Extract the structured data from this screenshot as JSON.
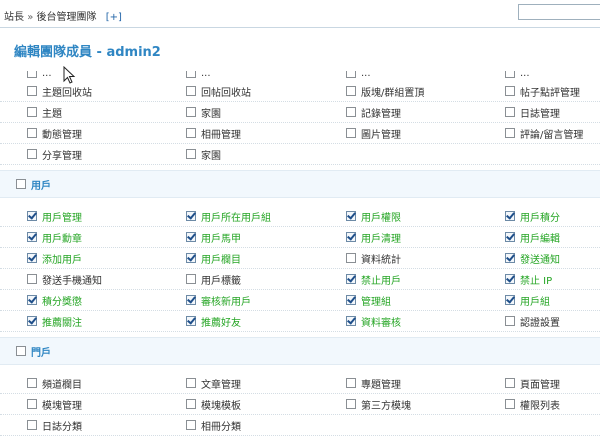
{
  "breadcrumb": {
    "home": "站長",
    "separator": "»",
    "current": "後台管理團隊",
    "add": "[+]"
  },
  "page_title": "編輯團隊成員 - admin2",
  "partial_row": {
    "items": [
      {
        "label": "...",
        "checked": false
      },
      {
        "label": "...",
        "checked": false
      },
      {
        "label": "...",
        "checked": false
      },
      {
        "label": "...",
        "checked": false
      }
    ]
  },
  "rows_top": [
    [
      {
        "label": "主題回收站",
        "checked": false,
        "green": false
      },
      {
        "label": "回帖回收站",
        "checked": false,
        "green": false
      },
      {
        "label": "版塊/群組置頂",
        "checked": false,
        "green": false
      },
      {
        "label": "帖子點評管理",
        "checked": false,
        "green": false
      }
    ],
    [
      {
        "label": "主題",
        "checked": false,
        "green": false
      },
      {
        "label": "家園",
        "checked": false,
        "green": false
      },
      {
        "label": "記錄管理",
        "checked": false,
        "green": false
      },
      {
        "label": "日誌管理",
        "checked": false,
        "green": false
      }
    ],
    [
      {
        "label": "動態管理",
        "checked": false,
        "green": false
      },
      {
        "label": "相冊管理",
        "checked": false,
        "green": false
      },
      {
        "label": "圖片管理",
        "checked": false,
        "green": false
      },
      {
        "label": "評論/留言管理",
        "checked": false,
        "green": false
      }
    ],
    [
      {
        "label": "分享管理",
        "checked": false,
        "green": false
      },
      {
        "label": "家園",
        "checked": false,
        "green": false
      }
    ]
  ],
  "groups": [
    {
      "title": "用戶",
      "checked": false,
      "rows": [
        [
          {
            "label": "用戶管理",
            "checked": true,
            "green": true
          },
          {
            "label": "用戶所在用戶組",
            "checked": true,
            "green": true
          },
          {
            "label": "用戶權限",
            "checked": true,
            "green": true
          },
          {
            "label": "用戶積分",
            "checked": true,
            "green": true
          }
        ],
        [
          {
            "label": "用戶勳章",
            "checked": true,
            "green": true
          },
          {
            "label": "用戶馬甲",
            "checked": true,
            "green": true
          },
          {
            "label": "用戶清理",
            "checked": true,
            "green": true
          },
          {
            "label": "用戶編輯",
            "checked": true,
            "green": true
          }
        ],
        [
          {
            "label": "添加用戶",
            "checked": true,
            "green": true
          },
          {
            "label": "用戶欄目",
            "checked": true,
            "green": true
          },
          {
            "label": "資料統計",
            "checked": false,
            "green": false
          },
          {
            "label": "發送通知",
            "checked": true,
            "green": true
          }
        ],
        [
          {
            "label": "發送手機通知",
            "checked": false,
            "green": false
          },
          {
            "label": "用戶標籤",
            "checked": false,
            "green": false
          },
          {
            "label": "禁止用戶",
            "checked": true,
            "green": true
          },
          {
            "label": "禁止 IP",
            "checked": true,
            "green": true
          }
        ],
        [
          {
            "label": "積分獎懲",
            "checked": true,
            "green": true
          },
          {
            "label": "審核新用戶",
            "checked": true,
            "green": true
          },
          {
            "label": "管理組",
            "checked": true,
            "green": true
          },
          {
            "label": "用戶組",
            "checked": true,
            "green": true
          }
        ],
        [
          {
            "label": "推薦關注",
            "checked": true,
            "green": true
          },
          {
            "label": "推薦好友",
            "checked": true,
            "green": true
          },
          {
            "label": "資料審核",
            "checked": true,
            "green": true
          },
          {
            "label": "認證設置",
            "checked": false,
            "green": false
          }
        ]
      ]
    },
    {
      "title": "門戶",
      "checked": false,
      "rows": [
        [
          {
            "label": "頻道欄目",
            "checked": false,
            "green": false
          },
          {
            "label": "文章管理",
            "checked": false,
            "green": false
          },
          {
            "label": "專題管理",
            "checked": false,
            "green": false
          },
          {
            "label": "頁面管理",
            "checked": false,
            "green": false
          }
        ],
        [
          {
            "label": "模塊管理",
            "checked": false,
            "green": false
          },
          {
            "label": "模塊模板",
            "checked": false,
            "green": false
          },
          {
            "label": "第三方模塊",
            "checked": false,
            "green": false
          },
          {
            "label": "權限列表",
            "checked": false,
            "green": false
          }
        ],
        [
          {
            "label": "日誌分類",
            "checked": false,
            "green": false
          },
          {
            "label": "相冊分類",
            "checked": false,
            "green": false
          }
        ]
      ]
    }
  ]
}
